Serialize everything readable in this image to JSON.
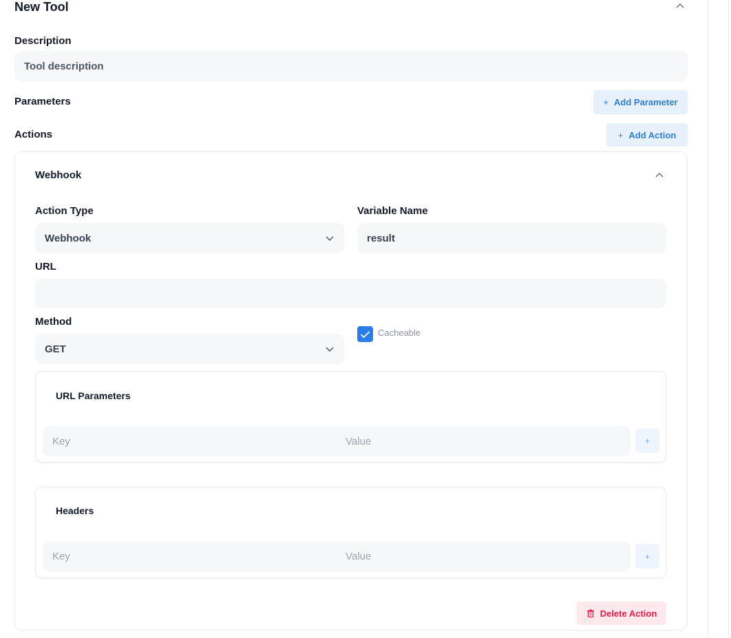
{
  "tool": {
    "title": "New Tool",
    "description_label": "Description",
    "description_value": "Tool description",
    "parameters_label": "Parameters",
    "add_parameter_label": "Add Parameter",
    "actions_label": "Actions",
    "add_action_label": "Add Action"
  },
  "action": {
    "title": "Webhook",
    "action_type_label": "Action Type",
    "action_type_value": "Webhook",
    "variable_name_label": "Variable Name",
    "variable_name_value": "result",
    "url_label": "URL",
    "url_value": "",
    "method_label": "Method",
    "method_value": "GET",
    "cacheable_label": "Cacheable",
    "cacheable_checked": true,
    "url_parameters": {
      "title": "URL Parameters",
      "key_placeholder": "Key",
      "value_placeholder": "Value"
    },
    "headers": {
      "title": "Headers",
      "key_placeholder": "Key",
      "value_placeholder": "Value"
    },
    "delete_label": "Delete Action"
  },
  "icons": {
    "plus": "+",
    "chevron_up": "chevron-up-icon",
    "chevron_down": "chevron-down-icon",
    "check": "check-icon",
    "trash": "trash-icon"
  },
  "colors": {
    "accent_blue": "#2f7dd3",
    "checkbox_blue": "#2b7de9",
    "danger": "#e11d48",
    "input_bg": "#f6f7f8"
  }
}
